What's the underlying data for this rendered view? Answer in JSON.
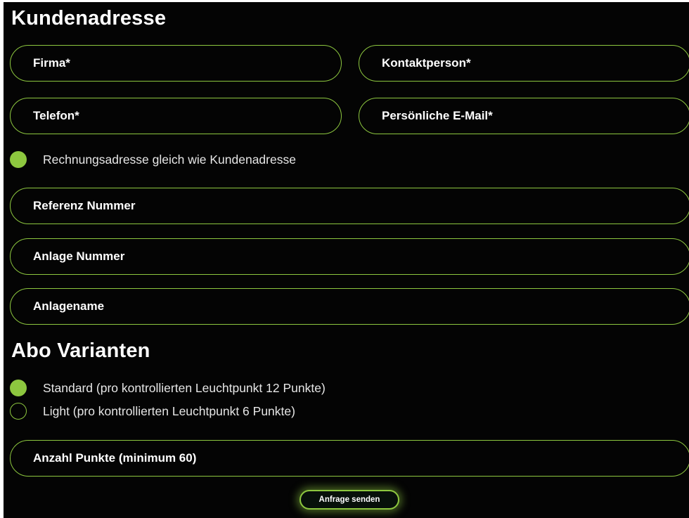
{
  "kundenadresse": {
    "heading": "Kundenadresse",
    "firma_placeholder": "Firma*",
    "kontaktperson_placeholder": "Kontaktperson*",
    "telefon_placeholder": "Telefon*",
    "email_placeholder": "Persönliche E-Mail*",
    "same_address_label": "Rechnungsadresse gleich wie Kundenadresse",
    "same_address_checked": true,
    "referenz_placeholder": "Referenz Nummer",
    "anlage_nummer_placeholder": "Anlage Nummer",
    "anlagename_placeholder": "Anlagename"
  },
  "abo": {
    "heading": "Abo Varianten",
    "options": [
      {
        "label": "Standard (pro kontrollierten Leuchtpunkt 12 Punkte)",
        "selected": true
      },
      {
        "label": "Light (pro kontrollierten Leuchtpunkt 6 Punkte)",
        "selected": false
      }
    ],
    "anzahl_placeholder": "Anzahl Punkte (minimum 60)"
  },
  "submit_label": "Anfrage senden",
  "colors": {
    "background": "#040404",
    "accent": "#8dc73f",
    "text": "#ffffff"
  }
}
